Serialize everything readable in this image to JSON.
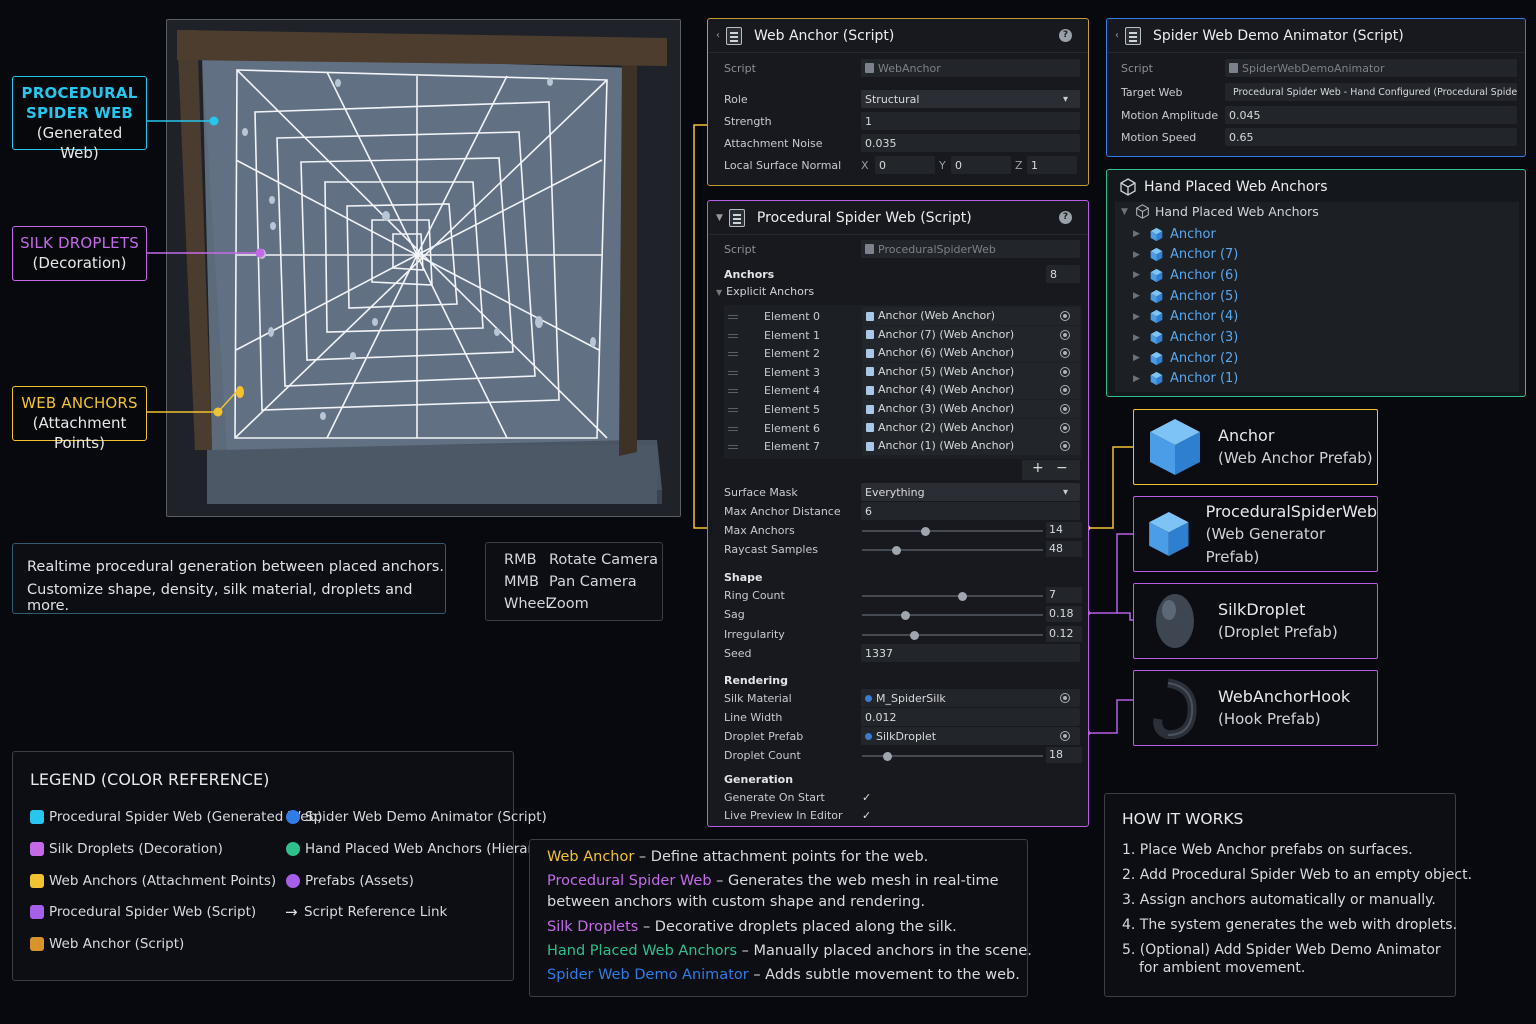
{
  "colors": {
    "cyan": "#27c6ee",
    "magenta": "#c46ae8",
    "yellow": "#f1c232",
    "purple": "#a75ee8",
    "orange": "#d9932b",
    "blue": "#2f7ce6",
    "green": "#2fbf8c",
    "link_blue": "#5aa8ee"
  },
  "callouts": {
    "web": {
      "title": "PROCEDURAL SPIDER WEB",
      "title_line1": "PROCEDURAL",
      "title_line2": "SPIDER WEB",
      "sub": "(Generated Web)"
    },
    "droplets": {
      "title": "SILK DROPLETS",
      "sub": "(Decoration)"
    },
    "anchors": {
      "title": "WEB ANCHORS",
      "sub": "(Attachment Points)"
    }
  },
  "intro": {
    "line1": "Realtime procedural generation between placed anchors.",
    "line2": "Customize shape, density, silk material, droplets and more."
  },
  "controls": [
    {
      "key": "RMB",
      "action": "Rotate Camera"
    },
    {
      "key": "MMB",
      "action": "Pan Camera"
    },
    {
      "key": "Wheel",
      "action": "Zoom"
    }
  ],
  "web_anchor": {
    "title": "Web Anchor (Script)",
    "script_label": "Script",
    "script_value": "WebAnchor",
    "role_label": "Role",
    "role_value": "Structural",
    "strength_label": "Strength",
    "strength_value": "1",
    "noise_label": "Attachment Noise",
    "noise_value": "0.035",
    "normal_label": "Local Surface Normal",
    "normal": {
      "x_label": "X",
      "x": "0",
      "y_label": "Y",
      "y": "0",
      "z_label": "Z",
      "z": "1"
    }
  },
  "demo_animator": {
    "title": "Spider Web Demo Animator (Script)",
    "script_label": "Script",
    "script_value": "SpiderWebDemoAnimator",
    "target_label": "Target Web",
    "target_value": "Procedural Spider Web - Hand Configured (Procedural Spider Web)",
    "amplitude_label": "Motion Amplitude",
    "amplitude_value": "0.045",
    "speed_label": "Motion Speed",
    "speed_value": "0.65"
  },
  "hierarchy": {
    "title": "Hand Placed Web Anchors",
    "root": "Hand Placed Web Anchors",
    "items": [
      "Anchor",
      "Anchor (7)",
      "Anchor (6)",
      "Anchor (5)",
      "Anchor (4)",
      "Anchor (3)",
      "Anchor (2)",
      "Anchor (1)"
    ]
  },
  "procedural": {
    "title": "Procedural Spider Web (Script)",
    "script_label": "Script",
    "script_value": "ProceduralSpiderWeb",
    "anchors_label": "Anchors",
    "anchors_value": "8",
    "explicit_label": "Explicit Anchors",
    "elements": [
      {
        "label": "Element 0",
        "value": "Anchor (Web Anchor)"
      },
      {
        "label": "Element 1",
        "value": "Anchor (7) (Web Anchor)"
      },
      {
        "label": "Element 2",
        "value": "Anchor (6) (Web Anchor)"
      },
      {
        "label": "Element 3",
        "value": "Anchor (5) (Web Anchor)"
      },
      {
        "label": "Element 4",
        "value": "Anchor (4) (Web Anchor)"
      },
      {
        "label": "Element 5",
        "value": "Anchor (3) (Web Anchor)"
      },
      {
        "label": "Element 6",
        "value": "Anchor (2) (Web Anchor)"
      },
      {
        "label": "Element 7",
        "value": "Anchor (1) (Web Anchor)"
      }
    ],
    "plus": "+",
    "minus": "−",
    "surface_mask_label": "Surface Mask",
    "surface_mask_value": "Everything",
    "max_dist_label": "Max Anchor Distance",
    "max_dist_value": "6",
    "max_anchors_label": "Max Anchors",
    "max_anchors_value": "14",
    "max_anchors_fraction": 0.35,
    "raycast_label": "Raycast Samples",
    "raycast_value": "48",
    "raycast_fraction": 0.19,
    "shape_label": "Shape",
    "ring_label": "Ring Count",
    "ring_value": "7",
    "ring_fraction": 0.55,
    "sag_label": "Sag",
    "sag_value": "0.18",
    "sag_fraction": 0.24,
    "irreg_label": "Irregularity",
    "irreg_value": "0.12",
    "irreg_fraction": 0.29,
    "seed_label": "Seed",
    "seed_value": "1337",
    "rendering_label": "Rendering",
    "silk_label": "Silk Material",
    "silk_value": "M_SpiderSilk",
    "width_label": "Line Width",
    "width_value": "0.012",
    "droplet_prefab_label": "Droplet Prefab",
    "droplet_prefab_value": "SilkDroplet",
    "droplet_count_label": "Droplet Count",
    "droplet_count_value": "18",
    "droplet_count_fraction": 0.14,
    "generation_label": "Generation",
    "gen_start_label": "Generate On Start",
    "live_label": "Live Preview In Editor",
    "check": "✓"
  },
  "prefabs": [
    {
      "name": "Anchor",
      "sub": "(Web Anchor Prefab)",
      "icon": "cube-icon"
    },
    {
      "name": "ProceduralSpiderWeb",
      "sub": "(Web Generator Prefab)",
      "icon": "cube-icon"
    },
    {
      "name": "SilkDroplet",
      "sub": "(Droplet Prefab)",
      "icon": "droplet-icon"
    },
    {
      "name": "WebAnchorHook",
      "sub": "(Hook Prefab)",
      "icon": "hook-icon"
    }
  ],
  "legend": {
    "title": "LEGEND (COLOR REFERENCE)",
    "left": [
      {
        "label": "Procedural Spider Web (Generated Web)",
        "color": "#27c6ee"
      },
      {
        "label": "Silk Droplets (Decoration)",
        "color": "#c46ae8"
      },
      {
        "label": "Web Anchors (Attachment Points)",
        "color": "#f1c232"
      },
      {
        "label": "Procedural Spider Web (Script)",
        "color": "#a75ee8"
      },
      {
        "label": "Web Anchor (Script)",
        "color": "#d9932b"
      }
    ],
    "right": [
      {
        "label": "Spider Web Demo Animator (Script)",
        "color": "#2f7ce6"
      },
      {
        "label": "Hand Placed Web Anchors (Hierarchy)",
        "color": "#2fbf8c"
      },
      {
        "label": "Prefabs (Assets)",
        "color": "#a75ee8"
      }
    ],
    "arrow": "→",
    "arrow_label": "Script Reference Link"
  },
  "descriptions": [
    {
      "name": "Web Anchor",
      "text": " – Define attachment points for the web.",
      "color": "#f1c232"
    },
    {
      "name": "Procedural Spider Web",
      "text": " – Generates the web mesh in real-time",
      "text2": "between anchors with custom shape and rendering.",
      "color": "#c46ae8"
    },
    {
      "name": "Silk Droplets",
      "text": " – Decorative droplets placed along the silk.",
      "color": "#c46ae8"
    },
    {
      "name": "Hand Placed Web Anchors",
      "text": " – Manually placed anchors in the scene.",
      "color": "#2fbf8c"
    },
    {
      "name": "Spider Web Demo Animator",
      "text": " – Adds subtle movement to the web.",
      "color": "#2f7ce6"
    }
  ],
  "how": {
    "title": "HOW IT WORKS",
    "steps": [
      "1.  Place Web Anchor prefabs on surfaces.",
      "2.  Add Procedural Spider Web to an empty object.",
      "3.  Assign anchors automatically or manually.",
      "4.  The system generates the web with droplets.",
      "5.  (Optional) Add Spider Web Demo Animator"
    ],
    "step5_cont": "for ambient movement."
  }
}
